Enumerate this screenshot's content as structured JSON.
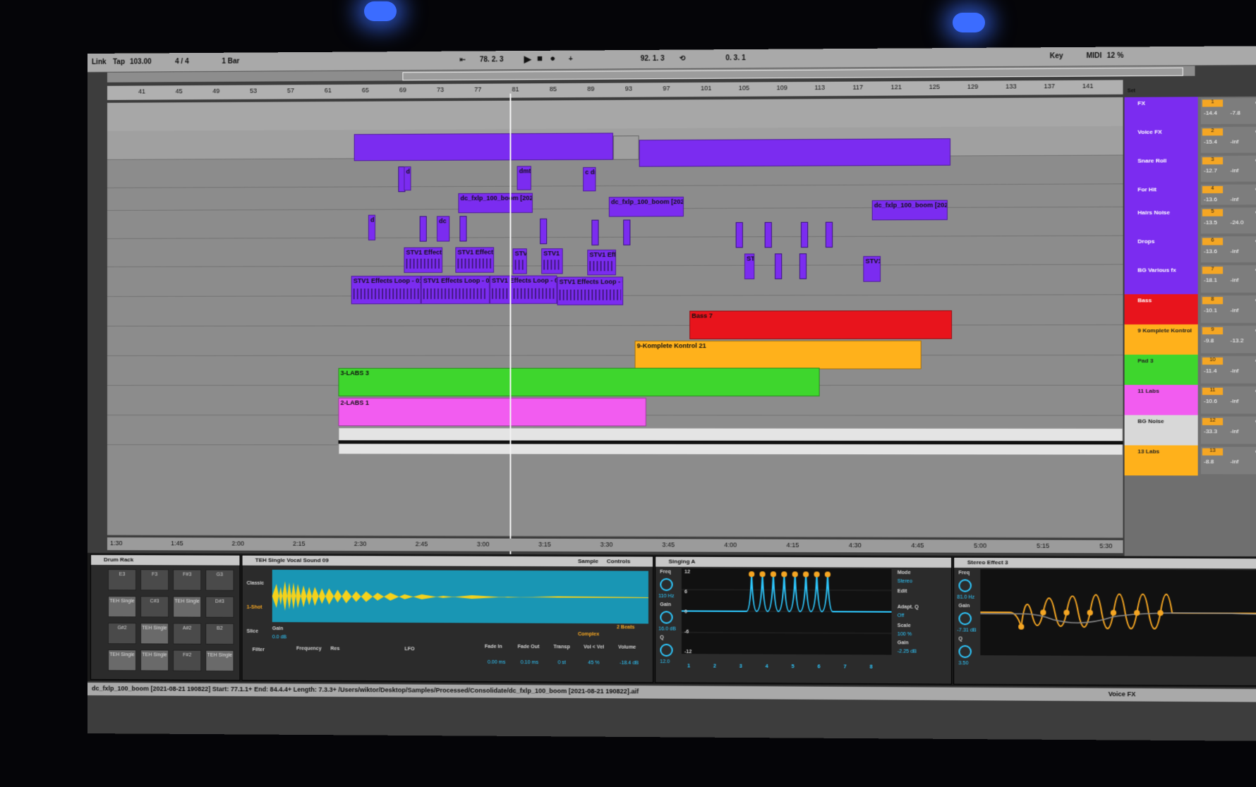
{
  "topbar": {
    "link": "Link",
    "tap": "Tap",
    "tempo": "103.00",
    "signature": "4 / 4",
    "quant": "1 Bar",
    "position": "78. 2. 3",
    "loop_start": "92. 1. 3",
    "loop_len": "0. 3. 1",
    "key": "Key",
    "midi": "MIDI",
    "cpu": "12 %"
  },
  "ruler_bars": [
    "41",
    "45",
    "49",
    "53",
    "57",
    "61",
    "65",
    "69",
    "73",
    "77",
    "81",
    "85",
    "89",
    "93",
    "97",
    "101",
    "105",
    "109",
    "113",
    "117",
    "121",
    "125",
    "129",
    "133",
    "137",
    "141"
  ],
  "time_ticks": [
    "1:30",
    "1:45",
    "2:00",
    "2:15",
    "2:30",
    "2:45",
    "3:00",
    "3:15",
    "3:30",
    "3:45",
    "4:00",
    "4:15",
    "4:30",
    "4:45",
    "5:00",
    "5:15",
    "5:30"
  ],
  "clips": {
    "drum_a": "d",
    "drum_b": "dmt",
    "drum_c": "c dn",
    "boom1": "dc_fxlp_100_boom [202",
    "boom2": "dc_fxlp_100_boom [202",
    "boom3": "dc_fxlp_100_boom [202",
    "hit1": "d",
    "hit2": "dc",
    "stv_e1": "STV1 Effect",
    "stv_e2": "STV1 Effect",
    "stv_e3": "STV",
    "stv_e4": "STV1",
    "stv_e5": "STV1 Effe",
    "stv_e6": "ST",
    "stv_e7": "STV1",
    "loop1": "STV1 Effects Loop - 012",
    "loop2": "STV1 Effects Loop - 012",
    "loop3": "STV1 Effects Loop - 012",
    "loop4": "STV1 Effects Loop - 012",
    "bass": "Bass 7",
    "kontrol": "9-Komplete Kontrol 21",
    "labs3": "3-LABS 3",
    "labs1": "2-LABS 1"
  },
  "set_label": "Set",
  "tracks": [
    {
      "name": "FX",
      "num": "1",
      "vol": "-14.4",
      "pan": "-7.8",
      "color": "#7b2cf0"
    },
    {
      "name": "Voice FX",
      "num": "2",
      "vol": "-15.4",
      "pan": "-inf",
      "color": "#7b2cf0"
    },
    {
      "name": "Snare Roll",
      "num": "3",
      "vol": "-12.7",
      "pan": "-inf",
      "color": "#7b2cf0"
    },
    {
      "name": "For Hit",
      "num": "4",
      "vol": "-13.6",
      "pan": "-inf",
      "color": "#7b2cf0"
    },
    {
      "name": "Hairs Noise",
      "num": "5",
      "vol": "-13.5",
      "pan": "-24.0",
      "color": "#7b2cf0"
    },
    {
      "name": "Drops",
      "num": "6",
      "vol": "-13.6",
      "pan": "-inf",
      "color": "#7b2cf0"
    },
    {
      "name": "BG Various fx",
      "num": "7",
      "vol": "-18.1",
      "pan": "-inf",
      "color": "#7b2cf0"
    },
    {
      "name": "Bass",
      "num": "8",
      "vol": "-10.1",
      "pan": "-inf",
      "color": "#e8141c"
    },
    {
      "name": "9 Komplete Kontrol",
      "num": "9",
      "vol": "-9.8",
      "pan": "-13.2",
      "color": "#ffb11b"
    },
    {
      "name": "Pad 3",
      "num": "10",
      "vol": "-11.4",
      "pan": "-inf",
      "color": "#3ed62d"
    },
    {
      "name": "11 Labs",
      "num": "11",
      "vol": "-10.6",
      "pan": "-inf",
      "color": "#f25cf0"
    },
    {
      "name": "BG Noise",
      "num": "12",
      "vol": "-33.3",
      "pan": "-inf",
      "color": "#d8d8d8"
    },
    {
      "name": "13 Labs",
      "num": "13",
      "vol": "-8.8",
      "pan": "-inf",
      "color": "#ffb11b"
    }
  ],
  "devices": {
    "drum_rack": {
      "title": "Drum Rack",
      "pads": [
        "E3",
        "F3",
        "F#3",
        "G3",
        "TEH Single",
        "C#3",
        "TEH Single",
        "D#3",
        "G#2",
        "TEH Single",
        "A#2",
        "B2",
        "TEH Single",
        "TEH Single",
        "F#2",
        "TEH Single"
      ]
    },
    "simpler": {
      "title": "TEH Single Vocal Sound 09",
      "tabs": [
        "Sample",
        "Controls"
      ],
      "modes": [
        "Classic",
        "1-Shot",
        "Slice"
      ],
      "gain_label": "Gain",
      "gain_val": "0.0 dB",
      "warp": "Complex",
      "beats": "2 Beats",
      "filter": "Filter",
      "frequency": "Frequency",
      "res": "Res",
      "lfo": "LFO",
      "fade_in": "Fade In",
      "fade_in_val": "0.00 ms",
      "fade_out": "Fade Out",
      "fade_out_val": "0.10 ms",
      "transp": "Transp",
      "transp_val": "0 st",
      "vel": "Vol < Vel",
      "vel_val": "45 %",
      "volume": "Volume",
      "volume_val": "-18.4 dB"
    },
    "eq": {
      "title": "Singing A",
      "freq": "Freq",
      "freq_val": "110 Hz",
      "gain": "Gain",
      "gain_val": "16.0 dB",
      "q": "Q",
      "q_val": "12.0",
      "mode": "Mode",
      "mode_val": "Stereo",
      "edit": "Edit",
      "adapt": "Adapt. Q",
      "adapt_val": "Off",
      "scale": "Scale",
      "scale_val": "100 %",
      "out_gain": "Gain",
      "out_gain_val": "-2.25 dB",
      "bands": [
        "1",
        "2",
        "3",
        "4",
        "5",
        "6",
        "7",
        "8"
      ],
      "grid": [
        "12",
        "6",
        "0",
        "-6",
        "-12"
      ]
    },
    "eq2": {
      "title": "Stereo Effect 3",
      "freq": "Freq",
      "freq_val": "81.0 Hz",
      "gain": "Gain",
      "gain_val": "-7.31 dB",
      "q": "Q",
      "q_val": "3.50"
    }
  },
  "status": {
    "text": "dc_fxlp_100_boom [2021-08-21 190822]  Start: 77.1.1+  End: 84.4.4+  Length: 7.3.3+  /Users/wiktor/Desktop/Samples/Processed/Consolidate/dc_fxlp_100_boom [2021-08-21 190822].aif",
    "right": "Voice FX"
  }
}
